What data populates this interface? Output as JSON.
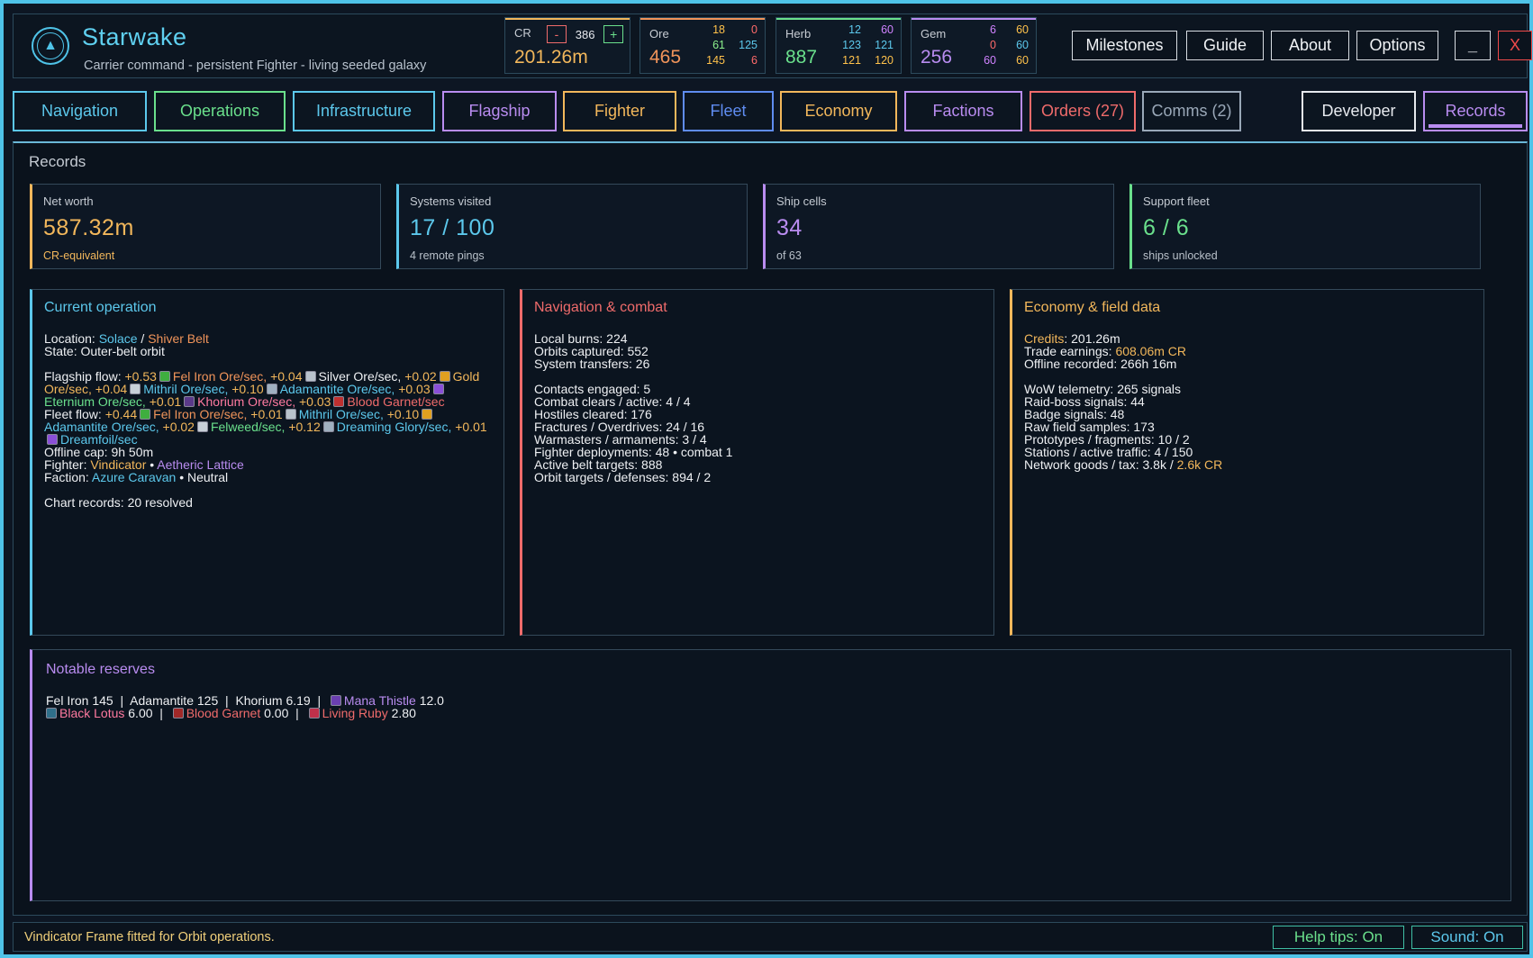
{
  "app": {
    "title": "Starwake",
    "subtitle": "Carrier command - persistent Fighter - living seeded galaxy"
  },
  "resources": {
    "cr": {
      "label": "CR",
      "minus": "-",
      "plus": "+",
      "step": "386",
      "value": "201.26m",
      "color": "#f2b75b"
    },
    "ore": {
      "label": "Ore",
      "value": "465",
      "grid": [
        [
          "18",
          "0"
        ],
        [
          "61",
          "125"
        ],
        [
          "145",
          "6"
        ]
      ],
      "color": "#f0945a"
    },
    "herb": {
      "label": "Herb",
      "value": "887",
      "grid": [
        [
          "12",
          "60"
        ],
        [
          "123",
          "121"
        ],
        [
          "121",
          "120"
        ]
      ],
      "color": "#6ae08c"
    },
    "gem": {
      "label": "Gem",
      "value": "256",
      "grid": [
        [
          "6",
          "60"
        ],
        [
          "0",
          "60"
        ],
        [
          "60",
          "60"
        ]
      ],
      "color": "#b98cf0"
    }
  },
  "header_buttons": {
    "milestones": "Milestones",
    "guide": "Guide",
    "about": "About",
    "options": "Options",
    "minimize": "_",
    "close": "X"
  },
  "tabs": [
    {
      "label": "Navigation",
      "color": "#5cc8ec"
    },
    {
      "label": "Operations",
      "color": "#6ae08c"
    },
    {
      "label": "Infrastructure",
      "color": "#5cc8ec"
    },
    {
      "label": "Flagship",
      "color": "#b98cf0"
    },
    {
      "label": "Fighter",
      "color": "#f2b75b"
    },
    {
      "label": "Fleet",
      "color": "#5f8cf0"
    },
    {
      "label": "Economy",
      "color": "#f2b75b"
    },
    {
      "label": "Factions",
      "color": "#b98cf0"
    },
    {
      "label": "Orders (27)",
      "color": "#ef6b6b"
    },
    {
      "label": "Comms (2)",
      "color": "#9aa8b8"
    },
    {
      "label": "Developer",
      "color": "#e6e9ee"
    },
    {
      "label": "Records",
      "color": "#b98cf0"
    }
  ],
  "records": {
    "title": "Records",
    "stats": [
      {
        "label": "Net worth",
        "value": "587.32m",
        "sub": "CR-equivalent",
        "color": "#f2b75b"
      },
      {
        "label": "Systems visited",
        "value": "17 / 100",
        "sub": "4 remote pings",
        "color": "#5cc8ec"
      },
      {
        "label": "Ship cells",
        "value": "34",
        "sub": "of 63",
        "color": "#b98cf0"
      },
      {
        "label": "Support fleet",
        "value": "6 / 6",
        "sub": "ships unlocked",
        "color": "#6ae08c"
      }
    ],
    "current_operation": {
      "title": "Current operation",
      "location_label": "Location: ",
      "location_a": "Solace",
      "location_sep": " / ",
      "location_b": "Shiver Belt",
      "state": "State: Outer-belt orbit",
      "flagship_flow_label": "Flagship flow: ",
      "fleet_flow_label": "Fleet flow: ",
      "offline_cap": "Offline cap: 9h 50m",
      "fighter_label": "Fighter: ",
      "fighter_a": "Vindicator",
      "fighter_sep": " • ",
      "fighter_b": "Aetheric Lattice",
      "faction_label": "Faction: ",
      "faction_a": "Azure Caravan",
      "faction_b": " • Neutral",
      "chart_records": "Chart records: 20 resolved"
    },
    "flagship_flow": [
      {
        "rate": "+0.53",
        "name": "Fel Iron Ore/sec,",
        "nc": "c-orange"
      },
      {
        "rate": "+0.04",
        "name": "Silver Ore/sec,",
        "nc": ""
      },
      {
        "rate": "+0.02",
        "name": "Gold Ore/sec,",
        "nc": "c-yellow"
      },
      {
        "rate": "+0.04",
        "name": "Mithril Ore/sec,",
        "nc": "c-cyan"
      },
      {
        "rate": "+0.10",
        "name": "Adamantite Ore/sec,",
        "nc": "c-cyan"
      },
      {
        "rate": "+0.03",
        "name": "Eternium Ore/sec,",
        "nc": "c-green"
      },
      {
        "rate": "+0.01",
        "name": "Khorium Ore/sec,",
        "nc": "c-pink"
      },
      {
        "rate": "+0.03",
        "name": "Blood Garnet/sec",
        "nc": "c-red"
      }
    ],
    "fleet_flow": [
      {
        "rate": "+0.44",
        "name": "Fel Iron Ore/sec,",
        "nc": "c-orange"
      },
      {
        "rate": "+0.01",
        "name": "Mithril Ore/sec,",
        "nc": "c-cyan"
      },
      {
        "rate": "+0.10",
        "name": "Adamantite Ore/sec,",
        "nc": "c-cyan"
      },
      {
        "rate": "+0.02",
        "name": "Felweed/sec,",
        "nc": "c-green"
      },
      {
        "rate": "+0.12",
        "name": "Dreaming Glory/sec,",
        "nc": "c-cyan"
      },
      {
        "rate": "+0.01",
        "name": "Dreamfoil/sec",
        "nc": "c-cyan"
      }
    ],
    "navigation_combat": {
      "title": "Navigation & combat",
      "lines_a": [
        "Local burns: 224",
        "Orbits captured: 552",
        "System transfers: 26"
      ],
      "lines_b": [
        "Contacts engaged: 5",
        "Combat clears / active: 4 / 4",
        "Hostiles cleared: 176",
        "Fractures / Overdrives: 24 / 16",
        "Warmasters / armaments: 3 / 4",
        "Fighter deployments: 48 • combat 1",
        "Active belt targets: 888",
        "Orbit targets / defenses: 894 / 2"
      ]
    },
    "economy": {
      "title": "Economy & field data",
      "credits_label": "Credits",
      "credits_value": ": 201.26m",
      "trade_label": "Trade earnings: ",
      "trade_value": "608.06m CR",
      "offline": "Offline recorded: 266h 16m",
      "lines_b": [
        "WoW telemetry: 265 signals",
        "Raid-boss signals: 44",
        "Badge signals: 48",
        "Raw field samples: 173",
        "Prototypes / fragments: 10 / 2",
        "Stations / active traffic: 4 / 150"
      ],
      "network_label": "Network goods / tax: 3.8k / ",
      "network_value": "2.6k CR"
    },
    "reserves": {
      "title": "Notable reserves",
      "fel_iron": "Fel Iron 145",
      "sep": "  |  ",
      "adamantite": "Adamantite 125",
      "khorium": "Khorium 6.19",
      "mana_name": "Mana Thistle",
      "mana_val": " 12.0",
      "lotus_name": "Black Lotus",
      "lotus_val": " 6.00",
      "garnet_name": "Blood Garnet",
      "garnet_val": " 0.00",
      "ruby_name": "Living Ruby",
      "ruby_val": " 2.80"
    }
  },
  "status": {
    "message": "Vindicator Frame fitted for Orbit operations.",
    "help": "Help tips: On",
    "sound": "Sound: On"
  }
}
